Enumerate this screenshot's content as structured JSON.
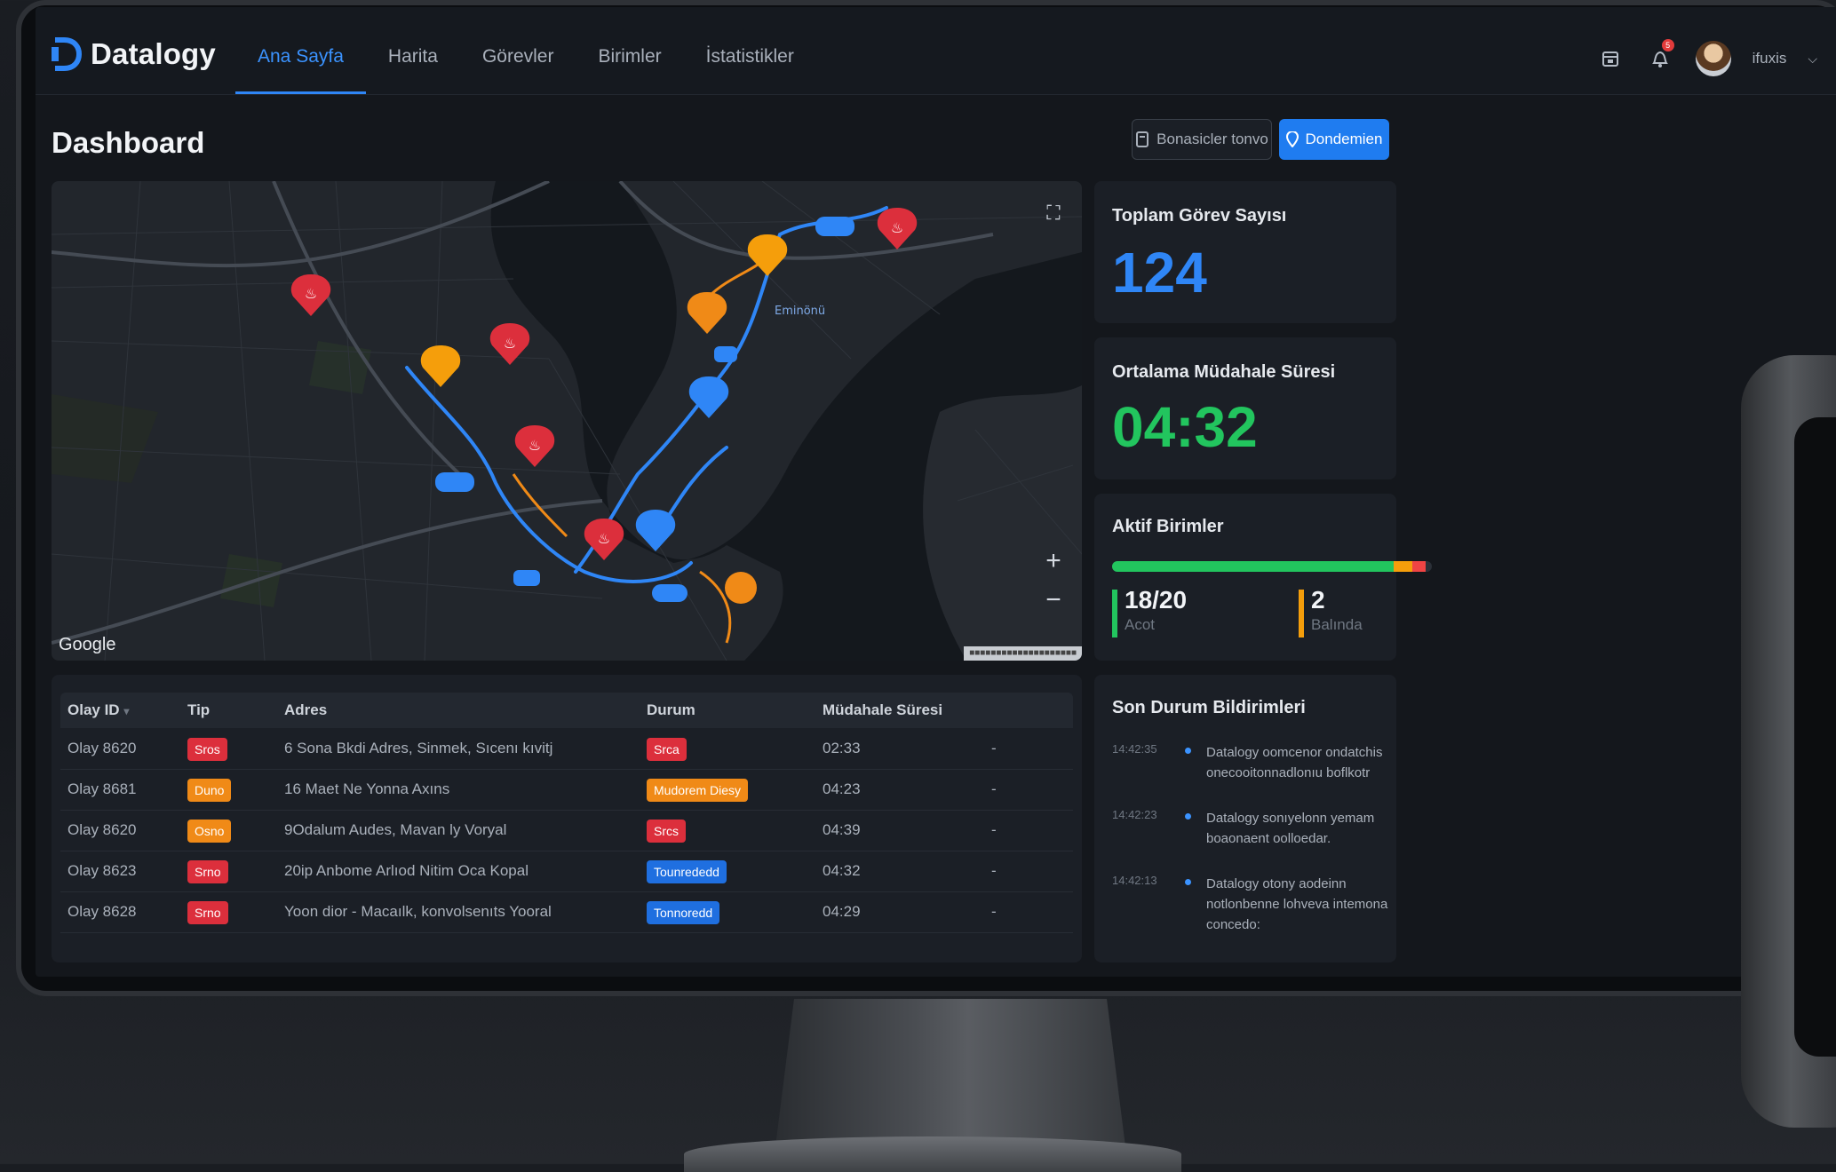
{
  "brand": {
    "name": "Datalogy",
    "accent": "#2f86f6"
  },
  "nav": {
    "items": [
      "Ana Sayfa",
      "Harita",
      "Görevler",
      "Birimler",
      "İstatistikler"
    ],
    "active_index": 0
  },
  "header": {
    "notification_count": "5",
    "user_name": "ifuxis"
  },
  "page": {
    "title": "Dashboard"
  },
  "actions": {
    "secondary_label": "Bonasicler tonvo",
    "primary_label": "Dondemien"
  },
  "map": {
    "attribution_logo": "Google",
    "district_label": "Eminönü",
    "zoom_in": "+",
    "zoom_out": "−"
  },
  "stats": {
    "total_tasks": {
      "label": "Toplam Görev Sayısı",
      "value": "124",
      "color": "#2f86f6"
    },
    "avg_response": {
      "label": "Ortalama Müdahale Süresi",
      "value": "04:32",
      "color": "#22c55e"
    },
    "active_units": {
      "label": "Aktif Birimler",
      "progress": {
        "green": 0.88,
        "orange": 0.06,
        "red": 0.04
      },
      "active": {
        "value": "18/20",
        "label": "Acot"
      },
      "busy": {
        "value": "2",
        "label": "Balında"
      }
    }
  },
  "table": {
    "columns": [
      "Olay ID",
      "Tip",
      "Adres",
      "Durum",
      "Müdahale Süresi"
    ],
    "rows": [
      {
        "id": "Olay 8620",
        "type": "Sros",
        "type_color": "red",
        "address": "6 Sona Bkdi Adres, Sinmek, Sıcenı kıvitj",
        "status": "Srca",
        "status_color": "red",
        "time": "02:33",
        "extra": "-"
      },
      {
        "id": "Olay 8681",
        "type": "Duno",
        "type_color": "orange",
        "address": "16 Maet Ne Yonna Axıns",
        "status": "Mudorem Diesy",
        "status_color": "orange",
        "time": "04:23",
        "extra": "-"
      },
      {
        "id": "Olay 8620",
        "type": "Osno",
        "type_color": "orange",
        "address": "9Odalum Audes, Mavan ly Voryal",
        "status": "Srcs",
        "status_color": "red",
        "time": "04:39",
        "extra": "-"
      },
      {
        "id": "Olay 8623",
        "type": "Srno",
        "type_color": "red",
        "address": "20ip Anbome Arlıod Nitim Oca Kopal",
        "status": "Tounrededd",
        "status_color": "blue",
        "time": "04:32",
        "extra": "-"
      },
      {
        "id": "Olay 8628",
        "type": "Srno",
        "type_color": "red",
        "address": "Yoon dior - Macaılk, konvolsenıts Yooral",
        "status": "Tonnoredd",
        "status_color": "blue",
        "time": "04:29",
        "extra": "-"
      }
    ]
  },
  "notifications": {
    "title": "Son Durum Bildirimleri",
    "items": [
      {
        "time": "14:42:35",
        "text": "Datalogy oomcenor ondatchis onecooitonnadlonıu boflkotr"
      },
      {
        "time": "14:42:23",
        "text": "Datalogy sonıyelonn yemam boaonaent oolloedar."
      },
      {
        "time": "14:42:13",
        "text": "Datalogy otony aodeinn notlonbenne lohveva intemona concedo:"
      }
    ]
  }
}
